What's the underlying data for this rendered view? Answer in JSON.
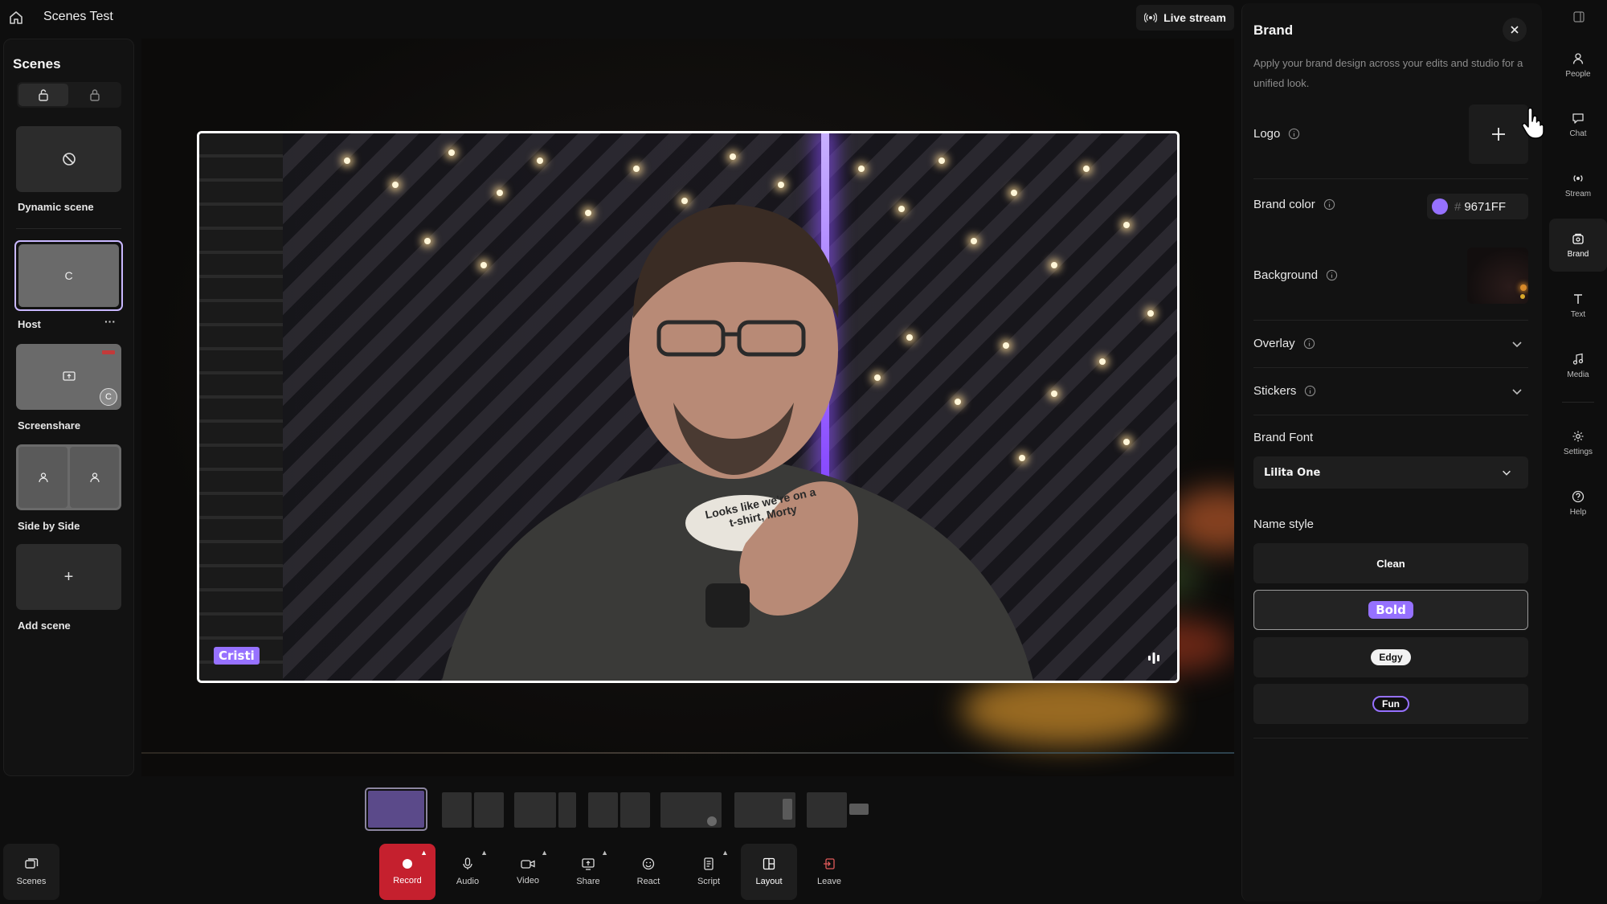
{
  "app": {
    "title": "Scenes Test",
    "live_stream_label": "Live stream"
  },
  "scenes": {
    "title": "Scenes",
    "items": [
      {
        "label": "Dynamic scene",
        "thumb_text": ""
      },
      {
        "label": "Host",
        "thumb_text": "C"
      },
      {
        "label": "Screenshare",
        "thumb_text": "C"
      },
      {
        "label": "Side by Side",
        "thumb_text": ""
      },
      {
        "label": "Add scene",
        "thumb_text": "+"
      }
    ],
    "more_label": "···"
  },
  "stage": {
    "participant_name": "Cristi",
    "shirt_text": "Looks like we're on a t-shirt, Morty"
  },
  "toolbar": {
    "scenes": "Scenes",
    "record": "Record",
    "audio": "Audio",
    "video": "Video",
    "share": "Share",
    "react": "React",
    "script": "Script",
    "layout": "Layout",
    "leave": "Leave"
  },
  "brand": {
    "title": "Brand",
    "description": "Apply your brand design across your edits and studio for a unified look.",
    "logo_label": "Logo",
    "brand_color_label": "Brand color",
    "brand_color_hash": "#",
    "brand_color_value": "9671FF",
    "background_label": "Background",
    "overlay_label": "Overlay",
    "stickers_label": "Stickers",
    "brand_font_label": "Brand Font",
    "brand_font_value": "Lilita One",
    "name_style_label": "Name style",
    "name_styles": [
      "Clean",
      "Bold",
      "Edgy",
      "Fun"
    ],
    "selected_name_style": "Bold"
  },
  "rail": {
    "people": "People",
    "chat": "Chat",
    "stream": "Stream",
    "brand": "Brand",
    "text": "Text",
    "media": "Media",
    "settings": "Settings",
    "help": "Help"
  },
  "colors": {
    "accent": "#9671FF",
    "record": "#c5202e",
    "panel": "#121212",
    "background": "#0e0e0e"
  }
}
